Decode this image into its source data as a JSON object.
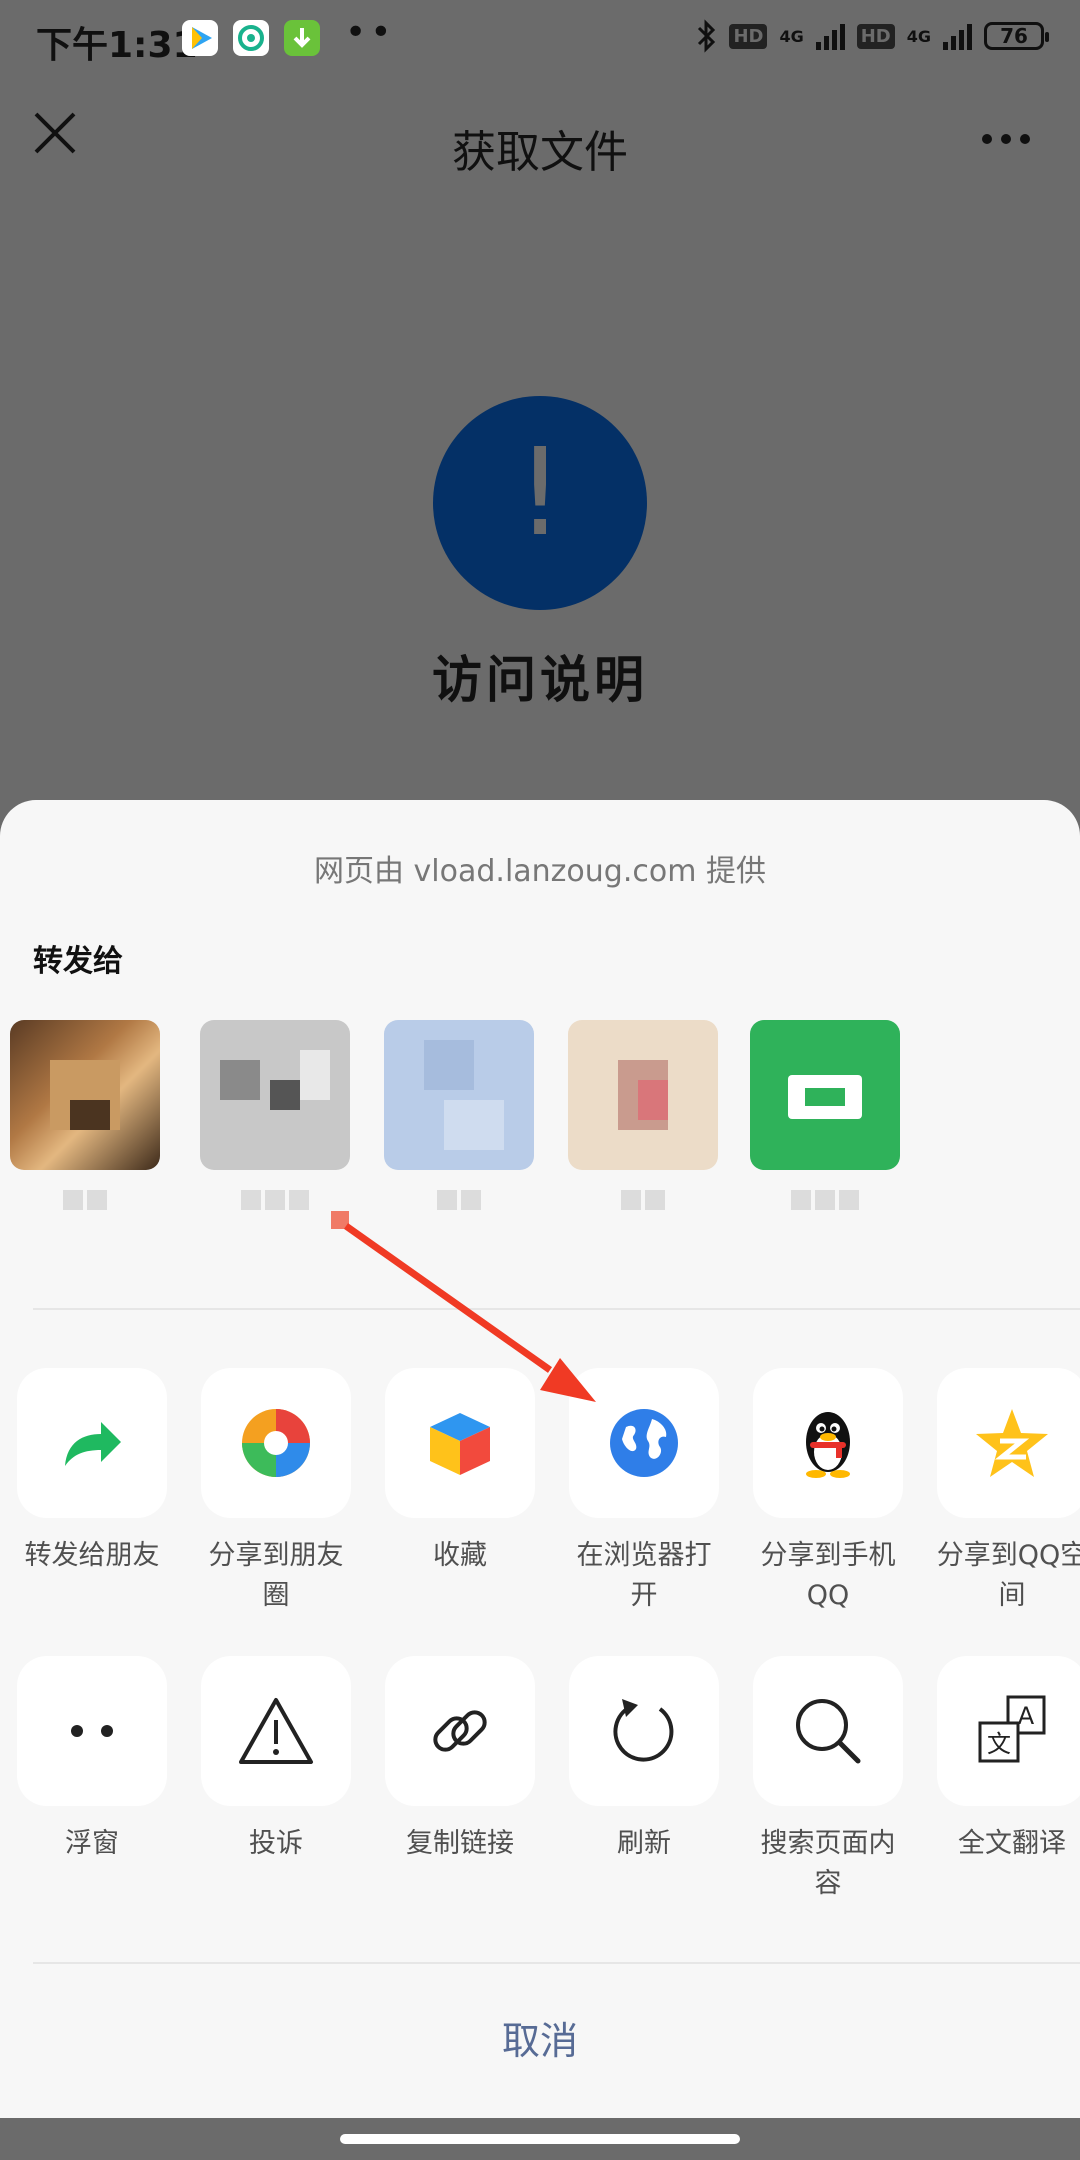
{
  "status_bar": {
    "time": "下午1:31",
    "network_1": "4G",
    "network_2": "4G",
    "hd_1": "HD",
    "hd_2": "HD",
    "battery": "76"
  },
  "title_bar": {
    "title": "获取文件"
  },
  "content": {
    "exclamation": "!",
    "heading": "访问说明"
  },
  "share_sheet": {
    "provider_text": "网页由 vload.lanzoug.com 提供",
    "forward_section_title": "转发给",
    "row1": [
      {
        "label": "转发给朋友",
        "icon": "forward-arrow-icon"
      },
      {
        "label": "分享到朋友圈",
        "icon": "moments-shutter-icon"
      },
      {
        "label": "收藏",
        "icon": "favorite-cube-icon"
      },
      {
        "label": "在浏览器打开",
        "icon": "browser-globe-icon"
      },
      {
        "label": "分享到手机QQ",
        "icon": "qq-penguin-icon"
      },
      {
        "label": "分享到QQ空间",
        "icon": "qzone-star-icon"
      }
    ],
    "row2": [
      {
        "label": "浮窗",
        "icon": "float-window-icon"
      },
      {
        "label": "投诉",
        "icon": "warning-triangle-icon"
      },
      {
        "label": "复制链接",
        "icon": "link-icon"
      },
      {
        "label": "刷新",
        "icon": "refresh-icon"
      },
      {
        "label": "搜索页面内容",
        "icon": "search-icon"
      },
      {
        "label": "全文翻译",
        "icon": "translate-icon"
      }
    ],
    "cancel_label": "取消",
    "translate_glyph_a": "A",
    "translate_glyph_wen": "文"
  },
  "colors": {
    "accent_blue": "#576b95",
    "info_circle": "#043066",
    "arrow_red": "#f03a24"
  }
}
